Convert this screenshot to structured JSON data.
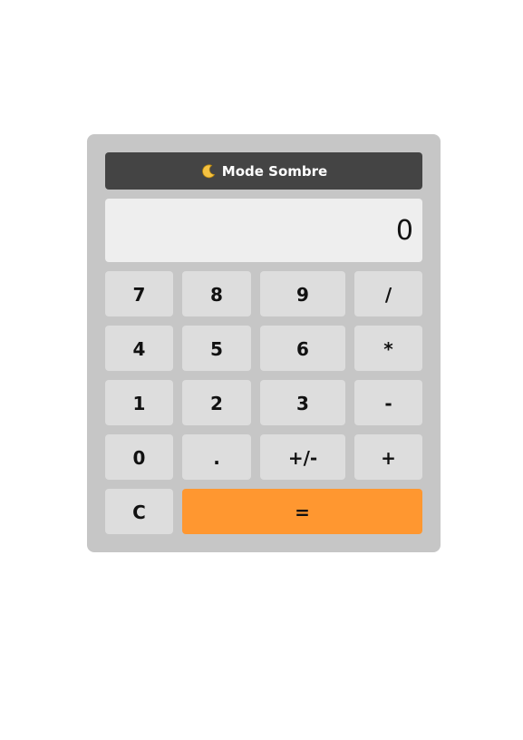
{
  "toggle": {
    "icon": "moon-icon",
    "label": "Mode Sombre"
  },
  "display": {
    "value": "0"
  },
  "keys": {
    "seven": "7",
    "eight": "8",
    "nine": "9",
    "divide": "/",
    "four": "4",
    "five": "5",
    "six": "6",
    "multiply": "*",
    "one": "1",
    "two": "2",
    "three": "3",
    "subtract": "-",
    "zero": "0",
    "decimal": ".",
    "negate": "+/-",
    "add": "+",
    "clear": "C",
    "equals": "="
  },
  "colors": {
    "calculator_bg": "#c6c6c6",
    "toggle_bg": "#444444",
    "display_bg": "#eeeeee",
    "key_bg": "#dddddd",
    "equals_bg": "#ff9730"
  }
}
